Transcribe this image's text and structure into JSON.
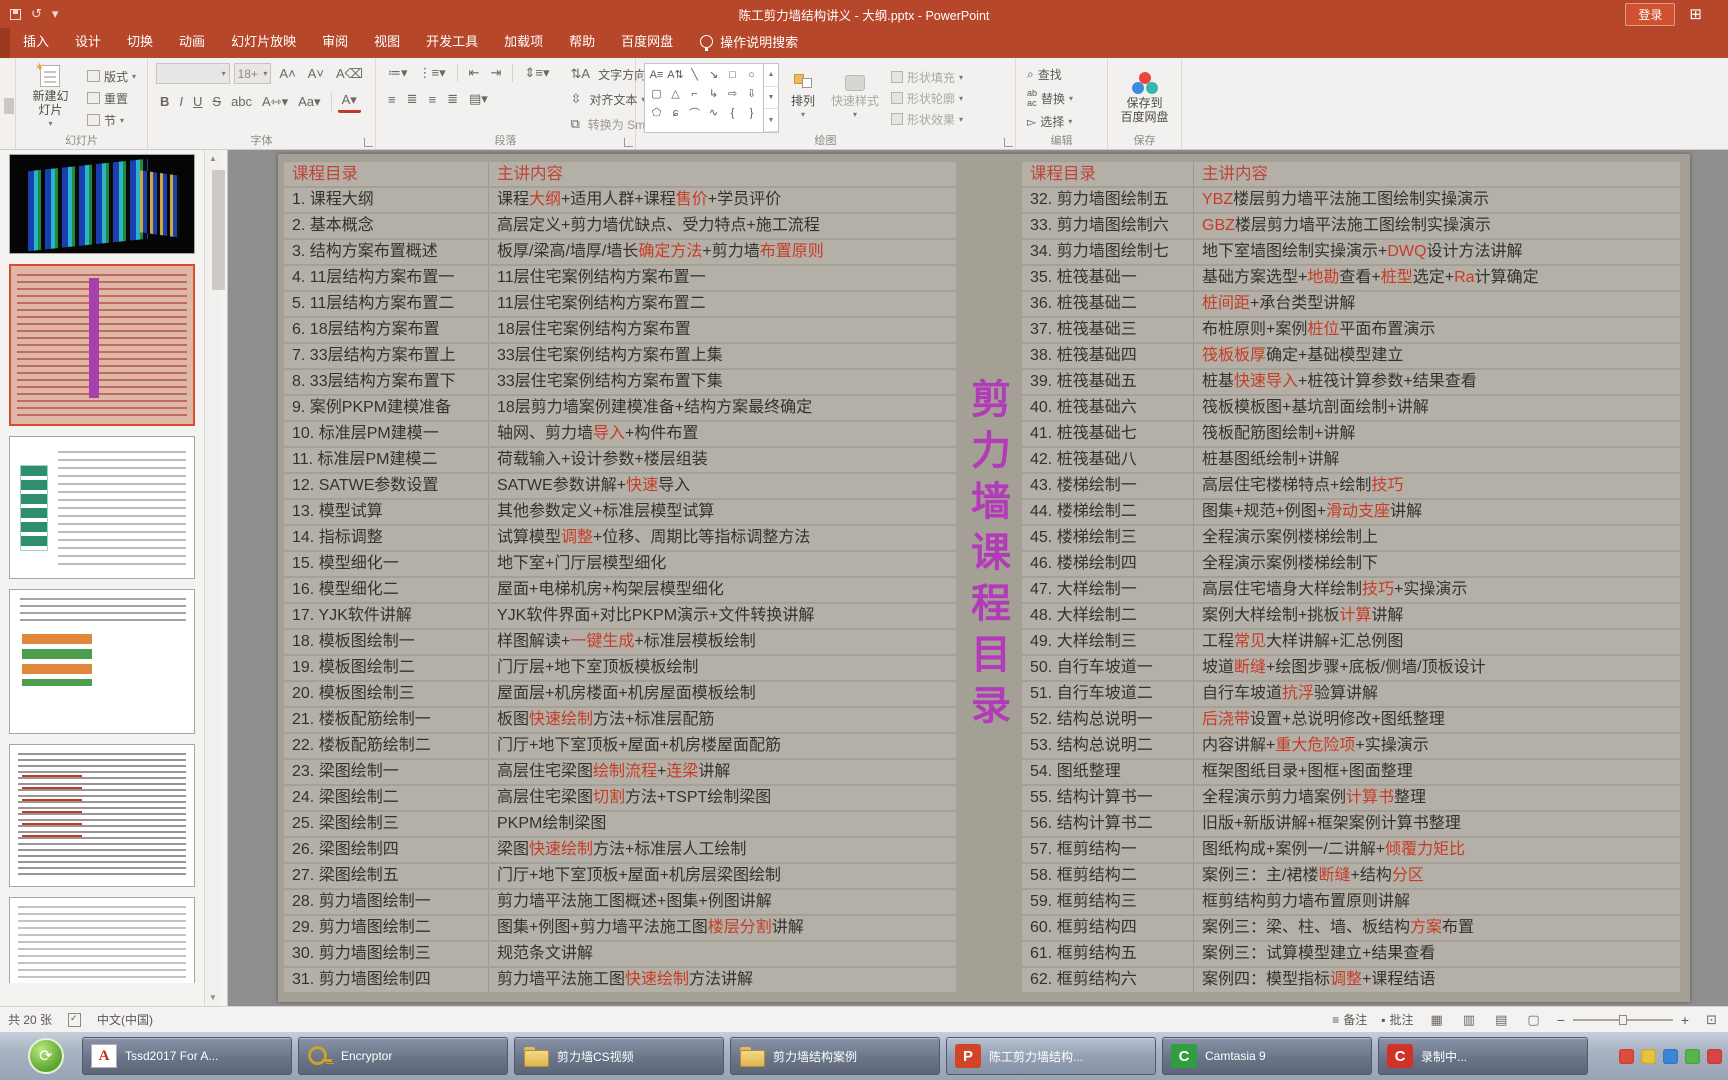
{
  "colors": {
    "titlebar": "#b7472a",
    "slidebg": "#a5a095",
    "rowbg": "#b5b0a7",
    "hdred": "#bf4437",
    "hl": "#c63c27",
    "purple": "#b23cb8"
  },
  "titlebar": {
    "title": "陈工剪力墙结构讲义 - 大纲.pptx  -  PowerPoint",
    "login": "登录"
  },
  "tabs": [
    "插入",
    "设计",
    "切换",
    "动画",
    "幻灯片放映",
    "审阅",
    "视图",
    "开发工具",
    "加载项",
    "帮助",
    "百度网盘"
  ],
  "search": "操作说明搜索",
  "ribbon": {
    "slides": {
      "label": "幻灯片",
      "new_slide": "新建幻灯片",
      "layout": "版式",
      "reset": "重置",
      "section": "节"
    },
    "font": {
      "label": "字体",
      "size": "18+"
    },
    "paragraph": {
      "label": "段落",
      "text_direction": "文字方向",
      "align_text": "对齐文本",
      "smartart": "转换为 SmartArt"
    },
    "drawing": {
      "label": "绘图",
      "arrange": "排列",
      "quick_styles": "快速样式",
      "shape_fill": "形状填充",
      "shape_outline": "形状轮廓",
      "shape_effects": "形状效果"
    },
    "editing": {
      "label": "编辑",
      "find": "查找",
      "replace": "替换",
      "select": "选择"
    },
    "save": {
      "label": "保存",
      "save_to_line1": "保存到",
      "save_to_line2": "百度网盘"
    }
  },
  "sidebar": {
    "thumbnails": [
      {
        "type": "model3d",
        "selected": false
      },
      {
        "type": "outline",
        "selected": true
      },
      {
        "type": "flow1",
        "selected": false
      },
      {
        "type": "flow2",
        "selected": false
      },
      {
        "type": "dense",
        "selected": false
      },
      {
        "type": "partial",
        "selected": false
      }
    ]
  },
  "slide": {
    "vertical_title": "剪力墙课程目录",
    "left_table": {
      "headers": [
        "课程目录",
        "主讲内容"
      ],
      "rows": [
        {
          "t": "1. 课程大纲",
          "c": [
            [
              "课程"
            ],
            [
              "大纲",
              1
            ],
            [
              "+适用人群+课程"
            ],
            [
              "售价",
              1
            ],
            [
              "+学员评价"
            ]
          ]
        },
        {
          "t": "2. 基本概念",
          "c": [
            [
              "高层定义+剪力墙优缺点、受力特点+施工流程"
            ]
          ]
        },
        {
          "t": "3. 结构方案布置概述",
          "c": [
            [
              "板厚/梁高/墙厚/墙长"
            ],
            [
              "确定方法",
              1
            ],
            [
              "+剪力墙"
            ],
            [
              "布置原则",
              1
            ]
          ]
        },
        {
          "t": "4. 11层结构方案布置一",
          "c": [
            [
              "11层住宅案例结构方案布置一"
            ]
          ]
        },
        {
          "t": "5. 11层结构方案布置二",
          "c": [
            [
              "11层住宅案例结构方案布置二"
            ]
          ]
        },
        {
          "t": "6. 18层结构方案布置",
          "c": [
            [
              "18层住宅案例结构方案布置"
            ]
          ]
        },
        {
          "t": "7. 33层结构方案布置上",
          "c": [
            [
              "33层住宅案例结构方案布置上集"
            ]
          ]
        },
        {
          "t": "8. 33层结构方案布置下",
          "c": [
            [
              "33层住宅案例结构方案布置下集"
            ]
          ]
        },
        {
          "t": "9. 案例PKPM建模准备",
          "c": [
            [
              "18层剪力墙案例建模准备+结构方案最终确定"
            ]
          ]
        },
        {
          "t": "10. 标准层PM建模一",
          "c": [
            [
              "轴网、剪力墙"
            ],
            [
              "导入",
              1
            ],
            [
              "+构件布置"
            ]
          ]
        },
        {
          "t": "11. 标准层PM建模二",
          "c": [
            [
              "荷载输入+设计参数+楼层组装"
            ]
          ]
        },
        {
          "t": "12. SATWE参数设置",
          "c": [
            [
              "SATWE参数讲解+"
            ],
            [
              "快速",
              1
            ],
            [
              "导入"
            ]
          ]
        },
        {
          "t": "13. 模型试算",
          "c": [
            [
              "其他参数定义+标准层模型试算"
            ]
          ]
        },
        {
          "t": "14. 指标调整",
          "c": [
            [
              "试算模型"
            ],
            [
              "调整",
              1
            ],
            [
              "+位移、周期比等指标调整方法"
            ]
          ]
        },
        {
          "t": "15. 模型细化一",
          "c": [
            [
              "地下室+门厅层模型细化"
            ]
          ]
        },
        {
          "t": "16. 模型细化二",
          "c": [
            [
              "屋面+电梯机房+构架层模型细化"
            ]
          ]
        },
        {
          "t": "17. YJK软件讲解",
          "c": [
            [
              "YJK软件界面+对比PKPM演示+文件转换讲解"
            ]
          ]
        },
        {
          "t": "18. 模板图绘制一",
          "c": [
            [
              "样图解读+"
            ],
            [
              "一键生成",
              1
            ],
            [
              "+标准层模板绘制"
            ]
          ]
        },
        {
          "t": "19. 模板图绘制二",
          "c": [
            [
              "门厅层+地下室顶板模板绘制"
            ]
          ]
        },
        {
          "t": "20. 模板图绘制三",
          "c": [
            [
              "屋面层+机房楼面+机房屋面模板绘制"
            ]
          ]
        },
        {
          "t": "21. 楼板配筋绘制一",
          "c": [
            [
              "板图"
            ],
            [
              "快速绘制",
              1
            ],
            [
              "方法+标准层配筋"
            ]
          ]
        },
        {
          "t": "22. 楼板配筋绘制二",
          "c": [
            [
              "门厅+地下室顶板+屋面+机房楼屋面配筋"
            ]
          ]
        },
        {
          "t": "23. 梁图绘制一",
          "c": [
            [
              "高层住宅梁图"
            ],
            [
              "绘制流程",
              1
            ],
            [
              "+"
            ],
            [
              "连梁",
              1
            ],
            [
              "讲解"
            ]
          ]
        },
        {
          "t": "24. 梁图绘制二",
          "c": [
            [
              "高层住宅梁图"
            ],
            [
              "切割",
              1
            ],
            [
              "方法+TSPT绘制梁图"
            ]
          ]
        },
        {
          "t": "25. 梁图绘制三",
          "c": [
            [
              "PKPM绘制梁图"
            ]
          ]
        },
        {
          "t": "26. 梁图绘制四",
          "c": [
            [
              "梁图"
            ],
            [
              "快速绘制",
              1
            ],
            [
              "方法+标准层人工绘制"
            ]
          ]
        },
        {
          "t": "27. 梁图绘制五",
          "c": [
            [
              "门厅+地下室顶板+屋面+机房层梁图绘制"
            ]
          ]
        },
        {
          "t": "28. 剪力墙图绘制一",
          "c": [
            [
              "剪力墙平法施工图概述+图集+例图讲解"
            ]
          ]
        },
        {
          "t": "29. 剪力墙图绘制二",
          "c": [
            [
              "图集+例图+剪力墙平法施工图"
            ],
            [
              "楼层分割",
              1
            ],
            [
              "讲解"
            ]
          ]
        },
        {
          "t": "30. 剪力墙图绘制三",
          "c": [
            [
              "规范条文讲解"
            ]
          ]
        },
        {
          "t": "31. 剪力墙图绘制四",
          "c": [
            [
              "剪力墙平法施工图"
            ],
            [
              "快速绘制",
              1
            ],
            [
              "方法讲解"
            ]
          ]
        }
      ]
    },
    "right_table": {
      "headers": [
        "课程目录",
        "主讲内容"
      ],
      "rows": [
        {
          "t": "32. 剪力墙图绘制五",
          "c": [
            [
              "YBZ",
              1
            ],
            [
              "楼层剪力墙平法施工图绘制实操演示"
            ]
          ]
        },
        {
          "t": "33. 剪力墙图绘制六",
          "c": [
            [
              "GBZ",
              1
            ],
            [
              "楼层剪力墙平法施工图绘制实操演示"
            ]
          ]
        },
        {
          "t": "34. 剪力墙图绘制七",
          "c": [
            [
              "地下室墙图绘制实操演示+"
            ],
            [
              "DWQ",
              1
            ],
            [
              "设计方法讲解"
            ]
          ]
        },
        {
          "t": "35. 桩筏基础一",
          "c": [
            [
              "基础方案选型+"
            ],
            [
              "地勘",
              1
            ],
            [
              "查看+"
            ],
            [
              "桩型",
              1
            ],
            [
              "选定+"
            ],
            [
              "Ra",
              1
            ],
            [
              "计算确定"
            ]
          ]
        },
        {
          "t": "36. 桩筏基础二",
          "c": [
            [
              "桩间距",
              1
            ],
            [
              "+承台类型讲解"
            ]
          ]
        },
        {
          "t": "37. 桩筏基础三",
          "c": [
            [
              "布桩原则+案例"
            ],
            [
              "桩位",
              1
            ],
            [
              "平面布置演示"
            ]
          ]
        },
        {
          "t": "38. 桩筏基础四",
          "c": [
            [
              "筏板板厚",
              1
            ],
            [
              "确定+基础模型建立"
            ]
          ]
        },
        {
          "t": "39. 桩筏基础五",
          "c": [
            [
              "桩基"
            ],
            [
              "快速导入",
              1
            ],
            [
              "+桩筏计算参数+结果查看"
            ]
          ]
        },
        {
          "t": "40. 桩筏基础六",
          "c": [
            [
              "筏板模板图+基坑剖面绘制+讲解"
            ]
          ]
        },
        {
          "t": "41. 桩筏基础七",
          "c": [
            [
              "筏板配筋图绘制+讲解"
            ]
          ]
        },
        {
          "t": "42. 桩筏基础八",
          "c": [
            [
              "桩基图纸绘制+讲解"
            ]
          ]
        },
        {
          "t": "43. 楼梯绘制一",
          "c": [
            [
              "高层住宅楼梯特点+绘制"
            ],
            [
              "技巧",
              1
            ]
          ]
        },
        {
          "t": "44. 楼梯绘制二",
          "c": [
            [
              "图集+规范+例图+"
            ],
            [
              "滑动支座",
              1
            ],
            [
              "讲解"
            ]
          ]
        },
        {
          "t": "45. 楼梯绘制三",
          "c": [
            [
              "全程演示案例楼梯绘制上"
            ]
          ]
        },
        {
          "t": "46. 楼梯绘制四",
          "c": [
            [
              "全程演示案例楼梯绘制下"
            ]
          ]
        },
        {
          "t": "47. 大样绘制一",
          "c": [
            [
              "高层住宅墙身大样绘制"
            ],
            [
              "技巧",
              1
            ],
            [
              "+实操演示"
            ]
          ]
        },
        {
          "t": "48. 大样绘制二",
          "c": [
            [
              "案例大样绘制+挑板"
            ],
            [
              "计算",
              1
            ],
            [
              "讲解"
            ]
          ]
        },
        {
          "t": "49. 大样绘制三",
          "c": [
            [
              "工程"
            ],
            [
              "常见",
              1
            ],
            [
              "大样讲解+汇总例图"
            ]
          ]
        },
        {
          "t": "50. 自行车坡道一",
          "c": [
            [
              "坡道"
            ],
            [
              "断缝",
              1
            ],
            [
              "+绘图步骤+底板/侧墙/顶板设计"
            ]
          ]
        },
        {
          "t": "51. 自行车坡道二",
          "c": [
            [
              "自行车坡道"
            ],
            [
              "抗浮",
              1
            ],
            [
              "验算讲解"
            ]
          ]
        },
        {
          "t": "52. 结构总说明一",
          "c": [
            [
              "后浇带",
              1
            ],
            [
              "设置+总说明修改+图纸整理"
            ]
          ]
        },
        {
          "t": "53. 结构总说明二",
          "c": [
            [
              "内容讲解+"
            ],
            [
              "重大危险项",
              1
            ],
            [
              "+实操演示"
            ]
          ]
        },
        {
          "t": "54. 图纸整理",
          "c": [
            [
              "框架图纸目录+图框+图面整理"
            ]
          ]
        },
        {
          "t": "55. 结构计算书一",
          "c": [
            [
              "全程演示剪力墙案例"
            ],
            [
              "计算书",
              1
            ],
            [
              "整理"
            ]
          ]
        },
        {
          "t": "56. 结构计算书二",
          "c": [
            [
              "旧版+新版讲解+框架案例计算书整理"
            ]
          ]
        },
        {
          "t": "57. 框剪结构一",
          "c": [
            [
              "图纸构成+案例一/二讲解+"
            ],
            [
              "倾覆力矩比",
              1
            ]
          ]
        },
        {
          "t": "58. 框剪结构二",
          "c": [
            [
              "案例三：主/裙楼"
            ],
            [
              "断缝",
              1
            ],
            [
              "+结构"
            ],
            [
              "分区",
              1
            ]
          ]
        },
        {
          "t": "59. 框剪结构三",
          "c": [
            [
              "框剪结构剪力墙布置原则讲解"
            ]
          ]
        },
        {
          "t": "60. 框剪结构四",
          "c": [
            [
              "案例三：梁、柱、墙、板结构"
            ],
            [
              "方案",
              1
            ],
            [
              "布置"
            ]
          ]
        },
        {
          "t": "61. 框剪结构五",
          "c": [
            [
              "案例三：试算模型建立+结果查看"
            ]
          ]
        },
        {
          "t": "62. 框剪结构六",
          "c": [
            [
              "案例四：模型指标"
            ],
            [
              "调整",
              1
            ],
            [
              "+课程结语"
            ]
          ]
        }
      ]
    }
  },
  "statusbar": {
    "slide_count": "共 20 张",
    "language": "中文(中国)",
    "notes": "备注",
    "comments": "批注"
  },
  "taskbar": {
    "items": [
      {
        "label": "Tssd2017 For A...",
        "icon": "tssd",
        "active": false
      },
      {
        "label": "Encryptor",
        "icon": "key",
        "active": false
      },
      {
        "label": "剪力墙CS视频",
        "icon": "folder",
        "active": false
      },
      {
        "label": "剪力墙结构案例",
        "icon": "folder",
        "active": false
      },
      {
        "label": "陈工剪力墙结构...",
        "icon": "ppt",
        "active": true
      },
      {
        "label": "Camtasia 9",
        "icon": "camtasia",
        "active": false
      },
      {
        "label": "录制中...",
        "icon": "rec",
        "active": false
      }
    ],
    "tray": [
      "#e04c3a",
      "#e8c33c",
      "#3a86d8",
      "#58b647",
      "#d84444"
    ]
  }
}
